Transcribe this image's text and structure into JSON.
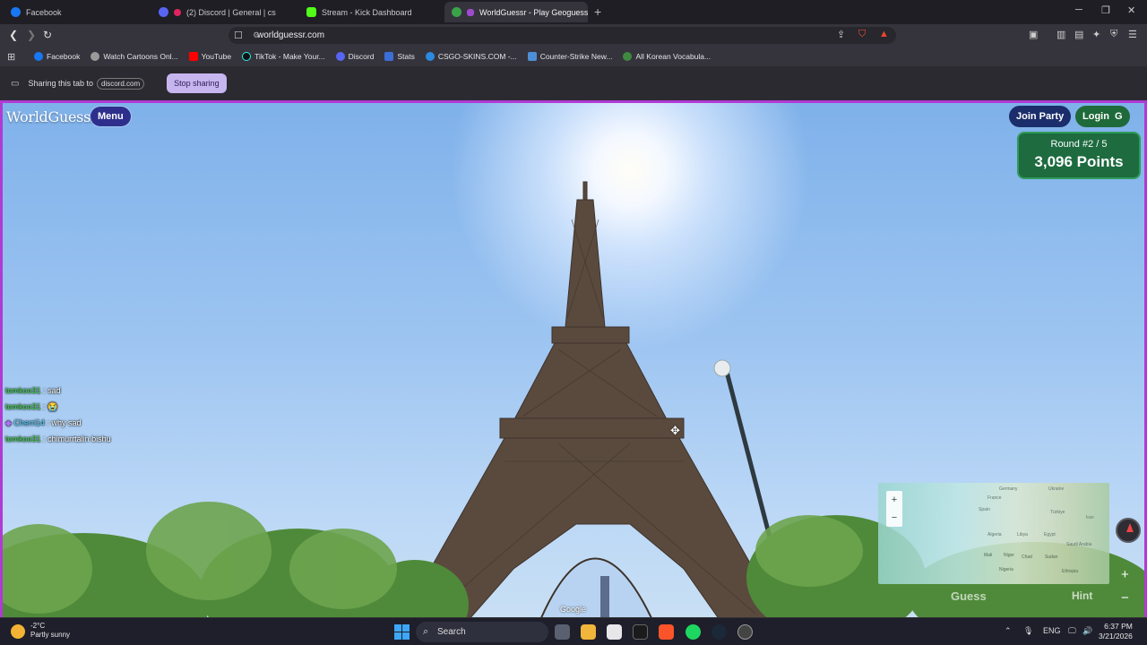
{
  "browser": {
    "tabs": [
      {
        "label": "Facebook",
        "active": false
      },
      {
        "label": "(2) Discord | General | cs",
        "active": false
      },
      {
        "label": "Stream - Kick Dashboard",
        "active": false
      },
      {
        "label": "WorldGuessr - Play Geoguess",
        "active": true
      }
    ],
    "url": "worldguessr.com",
    "bookmarks": [
      "Facebook",
      "Watch Cartoons Onl...",
      "YouTube",
      "TikTok - Make Your...",
      "Discord",
      "Stats",
      "CSGO-SKINS.COM -...",
      "Counter-Strike New...",
      "All Korean Vocabula..."
    ],
    "share_bar": {
      "text": "Sharing this tab to",
      "domain": "discord.com",
      "stop_label": "Stop sharing"
    }
  },
  "game": {
    "logo": "WorldGuessr",
    "menu_label": "Menu",
    "join_party_label": "Join Party",
    "login_label": "Login",
    "login_icon": "G",
    "round_text": "Round #2 / 5",
    "points_text": "3,096 Points",
    "guess_label": "Guess",
    "hint_label": "Hint",
    "attribution": "Google",
    "map_labels": [
      "Germany",
      "Ukraine",
      "France",
      "Spain",
      "Türkiye",
      "Iran",
      "Algeria",
      "Libya",
      "Egypt",
      "Saudi Arabia",
      "Mali",
      "Niger",
      "Chad",
      "Sudan",
      "Nigeria",
      "Ethiopia"
    ],
    "chat": [
      {
        "user": "tomkoo31",
        "sep": ":",
        "msg": "sad"
      },
      {
        "user": "tomkoo31",
        "sep": ":",
        "msg": "😭"
      },
      {
        "user": "Cherri14",
        "sep": ":",
        "msg": "why sad"
      },
      {
        "user": "tomkoo31",
        "sep": ":",
        "msg": "chimurrtalin bishu"
      }
    ]
  },
  "taskbar": {
    "weather_temp": "-2°C",
    "weather_desc": "Partly sunny",
    "search_label": "Search",
    "lang": "ENG",
    "time": "6:37 PM",
    "date": "3/21/2026"
  }
}
